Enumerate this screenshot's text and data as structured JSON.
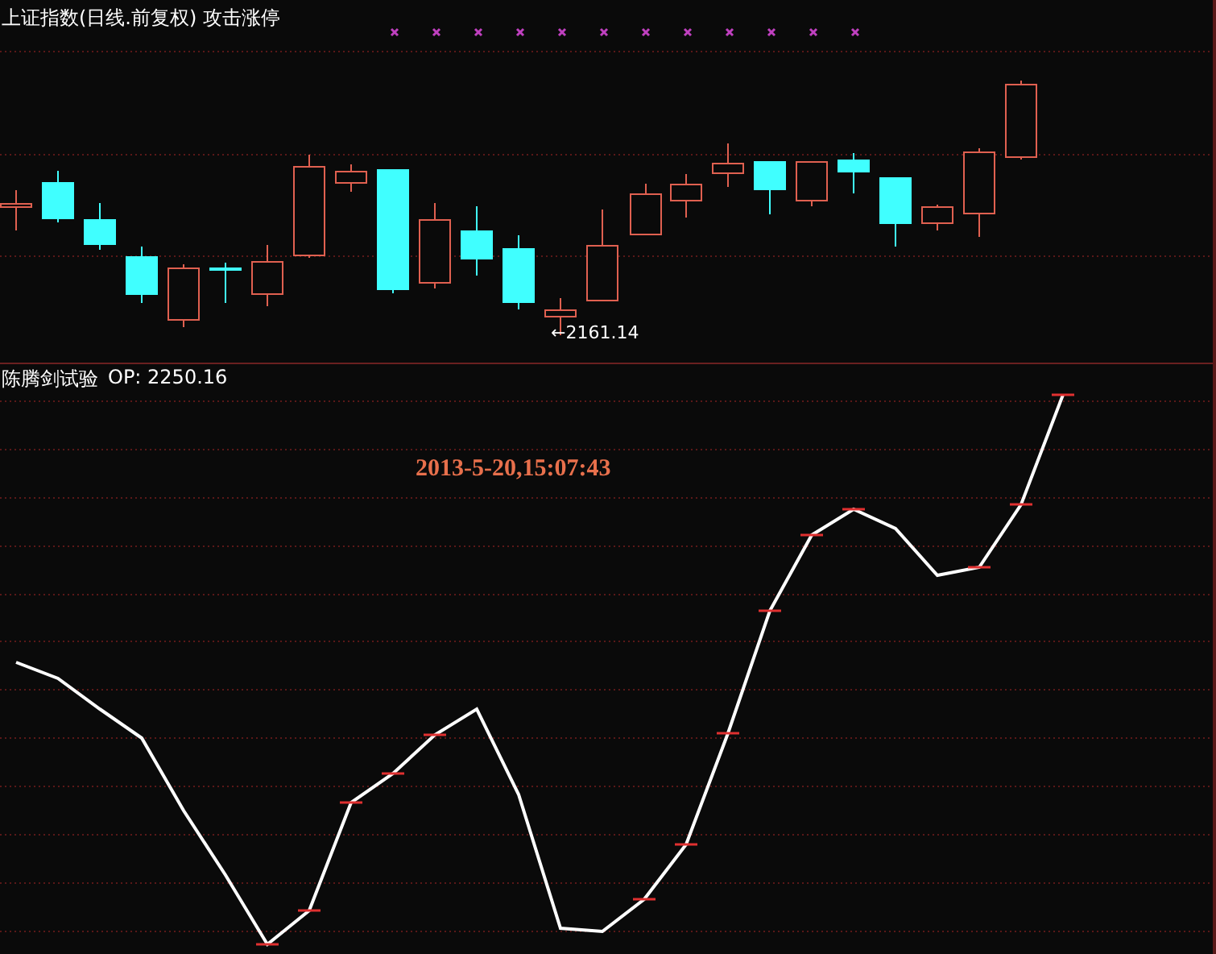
{
  "price_panel": {
    "title": "上证指数(日线.前复权) 攻击涨停",
    "low_label": "←2161.14"
  },
  "indicator_panel": {
    "name": "陈腾剑试验",
    "value": "OP: 2250.16",
    "timestamp": "2013-5-20,15:07:43"
  }
}
